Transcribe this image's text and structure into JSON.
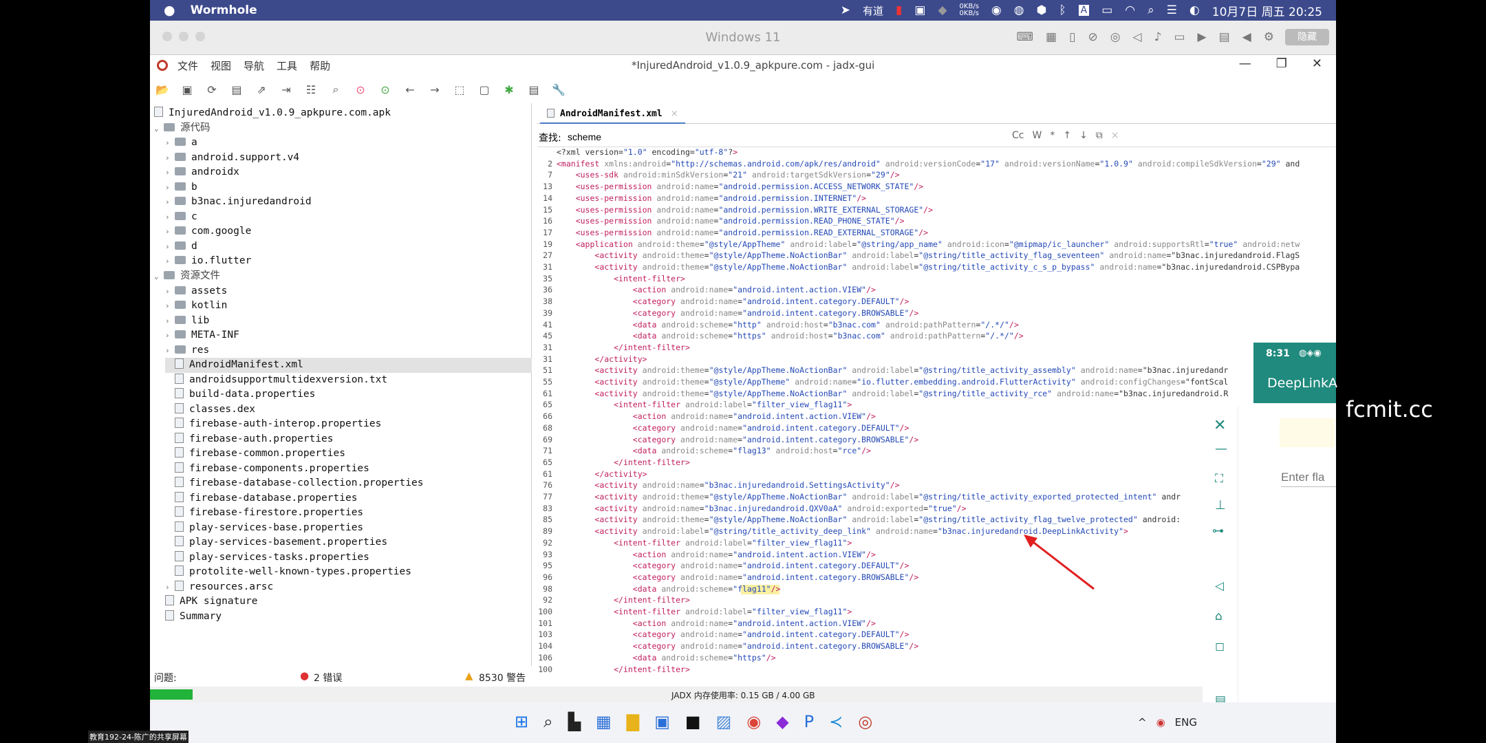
{
  "mac_bar": {
    "app_name": "Wormhole",
    "net_up": "0KB/s",
    "net_down": "0KB/s",
    "youdao": "有道",
    "datetime": "10月7日 周五 20:25"
  },
  "vm_bar": {
    "title": "Windows 11",
    "button": "隐藏"
  },
  "app": {
    "title": "*InjuredAndroid_v1.0.9_apkpure.com - jadx-gui",
    "menu": [
      "文件",
      "视图",
      "导航",
      "工具",
      "帮助"
    ],
    "tree": {
      "root": "InjuredAndroid_v1.0.9_apkpure.com.apk",
      "source_label": "源代码",
      "packages": [
        "a",
        "android.support.v4",
        "androidx",
        "b",
        "b3nac.injuredandroid",
        "c",
        "com.google",
        "d",
        "io.flutter"
      ],
      "resources_label": "资源文件",
      "res_folders": [
        "assets",
        "kotlin",
        "lib",
        "META-INF",
        "res"
      ],
      "res_files": [
        "AndroidManifest.xml",
        "androidsupportmultidexversion.txt",
        "build-data.properties",
        "classes.dex",
        "firebase-auth-interop.properties",
        "firebase-auth.properties",
        "firebase-common.properties",
        "firebase-components.properties",
        "firebase-database-collection.properties",
        "firebase-database.properties",
        "firebase-firestore.properties",
        "play-services-base.properties",
        "play-services-basement.properties",
        "play-services-tasks.properties",
        "protolite-well-known-types.properties",
        "resources.arsc"
      ],
      "apk_signature": "APK signature",
      "summary": "Summary"
    },
    "tab": "AndroidManifest.xml",
    "find": {
      "label": "查找:",
      "value": "scheme",
      "opt_cc": "Cc",
      "opt_w": "W",
      "opt_star": "*"
    },
    "code_lines": [
      {
        "n": "",
        "t": "<?xml version=\"1.0\" encoding=\"utf-8\"?>"
      },
      {
        "n": "2",
        "t": "<manifest xmlns:android=\"http://schemas.android.com/apk/res/android\" android:versionCode=\"17\" android:versionName=\"1.0.9\" android:compileSdkVersion=\"29\" and"
      },
      {
        "n": "7",
        "t": "    <uses-sdk android:minSdkVersion=\"21\" android:targetSdkVersion=\"29\"/>"
      },
      {
        "n": "13",
        "t": "    <uses-permission android:name=\"android.permission.ACCESS_NETWORK_STATE\"/>"
      },
      {
        "n": "14",
        "t": "    <uses-permission android:name=\"android.permission.INTERNET\"/>"
      },
      {
        "n": "15",
        "t": "    <uses-permission android:name=\"android.permission.WRITE_EXTERNAL_STORAGE\"/>"
      },
      {
        "n": "16",
        "t": "    <uses-permission android:name=\"android.permission.READ_PHONE_STATE\"/>"
      },
      {
        "n": "17",
        "t": "    <uses-permission android:name=\"android.permission.READ_EXTERNAL_STORAGE\"/>"
      },
      {
        "n": "19",
        "t": "    <application android:theme=\"@style/AppTheme\" android:label=\"@string/app_name\" android:icon=\"@mipmap/ic_launcher\" android:supportsRtl=\"true\" android:netw"
      },
      {
        "n": "27",
        "t": "        <activity android:theme=\"@style/AppTheme.NoActionBar\" android:label=\"@string/title_activity_flag_seventeen\" android:name=\"b3nac.injuredandroid.FlagS"
      },
      {
        "n": "31",
        "t": "        <activity android:theme=\"@style/AppTheme.NoActionBar\" android:label=\"@string/title_activity_c_s_p_bypass\" android:name=\"b3nac.injuredandroid.CSPBypa"
      },
      {
        "n": "35",
        "t": "            <intent-filter>"
      },
      {
        "n": "36",
        "t": "                <action android:name=\"android.intent.action.VIEW\"/>"
      },
      {
        "n": "38",
        "t": "                <category android:name=\"android.intent.category.DEFAULT\"/>"
      },
      {
        "n": "39",
        "t": "                <category android:name=\"android.intent.category.BROWSABLE\"/>"
      },
      {
        "n": "41",
        "t": "                <data android:scheme=\"http\" android:host=\"b3nac.com\" android:pathPattern=\"/.*/\"/>"
      },
      {
        "n": "45",
        "t": "                <data android:scheme=\"https\" android:host=\"b3nac.com\" android:pathPattern=\"/.*/\"/>"
      },
      {
        "n": "31",
        "t": "            </intent-filter>"
      },
      {
        "n": "31",
        "t": "        </activity>"
      },
      {
        "n": "51",
        "t": "        <activity android:theme=\"@style/AppTheme.NoActionBar\" android:label=\"@string/title_activity_assembly\" android:name=\"b3nac.injuredandr"
      },
      {
        "n": "55",
        "t": "        <activity android:theme=\"@style/AppTheme\" android:name=\"io.flutter.embedding.android.FlutterActivity\" android:configChanges=\"fontScal"
      },
      {
        "n": "61",
        "t": "        <activity android:theme=\"@style/AppTheme.NoActionBar\" android:label=\"@string/title_activity_rce\" android:name=\"b3nac.injuredandroid.R"
      },
      {
        "n": "65",
        "t": "            <intent-filter android:label=\"filter_view_flag11\">"
      },
      {
        "n": "66",
        "t": "                <action android:name=\"android.intent.action.VIEW\"/>"
      },
      {
        "n": "68",
        "t": "                <category android:name=\"android.intent.category.DEFAULT\"/>"
      },
      {
        "n": "69",
        "t": "                <category android:name=\"android.intent.category.BROWSABLE\"/>"
      },
      {
        "n": "71",
        "t": "                <data android:scheme=\"flag13\" android:host=\"rce\"/>"
      },
      {
        "n": "65",
        "t": "            </intent-filter>"
      },
      {
        "n": "61",
        "t": "        </activity>"
      },
      {
        "n": "76",
        "t": "        <activity android:name=\"b3nac.injuredandroid.SettingsActivity\"/>"
      },
      {
        "n": "77",
        "t": "        <activity android:theme=\"@style/AppTheme.NoActionBar\" android:label=\"@string/title_activity_exported_protected_intent\" andr"
      },
      {
        "n": "83",
        "t": "        <activity android:name=\"b3nac.injuredandroid.QXV0aA\" android:exported=\"true\"/>"
      },
      {
        "n": "85",
        "t": "        <activity android:theme=\"@style/AppTheme.NoActionBar\" android:label=\"@string/title_activity_flag_twelve_protected\" android:"
      },
      {
        "n": "89",
        "t": "        <activity android:label=\"@string/title_activity_deep_link\" android:name=\"b3nac.injuredandroid.DeepLinkActivity\">"
      },
      {
        "n": "92",
        "t": "            <intent-filter android:label=\"filter_view_flag11\">"
      },
      {
        "n": "93",
        "t": "                <action android:name=\"android.intent.action.VIEW\"/>"
      },
      {
        "n": "95",
        "t": "                <category android:name=\"android.intent.category.DEFAULT\"/>"
      },
      {
        "n": "96",
        "t": "                <category android:name=\"android.intent.category.BROWSABLE\"/>"
      },
      {
        "n": "98",
        "t": "                <data android:scheme=\"flag11\"/>"
      },
      {
        "n": "92",
        "t": "            </intent-filter>"
      },
      {
        "n": "100",
        "t": "            <intent-filter android:label=\"filter_view_flag11\">"
      },
      {
        "n": "101",
        "t": "                <action android:name=\"android.intent.action.VIEW\"/>"
      },
      {
        "n": "103",
        "t": "                <category android:name=\"android.intent.category.DEFAULT\"/>"
      },
      {
        "n": "104",
        "t": "                <category android:name=\"android.intent.category.BROWSABLE\"/>"
      },
      {
        "n": "106",
        "t": "                <data android:scheme=\"https\"/>"
      },
      {
        "n": "100",
        "t": "            </intent-filter>"
      }
    ],
    "status": {
      "problems_label": "问题:",
      "errors": "2 错误",
      "warnings": "8530 警告",
      "memory": "JADX 内存使用率:  0.15 GB / 4.00 GB"
    }
  },
  "phone": {
    "time": "8:31",
    "app_title": "DeepLinkA",
    "input_placeholder": "Enter fla"
  },
  "watermark_site": "fcmit.cc",
  "share_label": "教育192-24-陈广的共享屏幕",
  "taskbar": {
    "lang": "ENG"
  },
  "colors": {
    "mac_bar": "#3c4a8c",
    "tag": "#c01d5d",
    "string": "#2348b5",
    "highlight": "#f5e663",
    "arrow": "#e02020",
    "progress": "#22b33a"
  }
}
